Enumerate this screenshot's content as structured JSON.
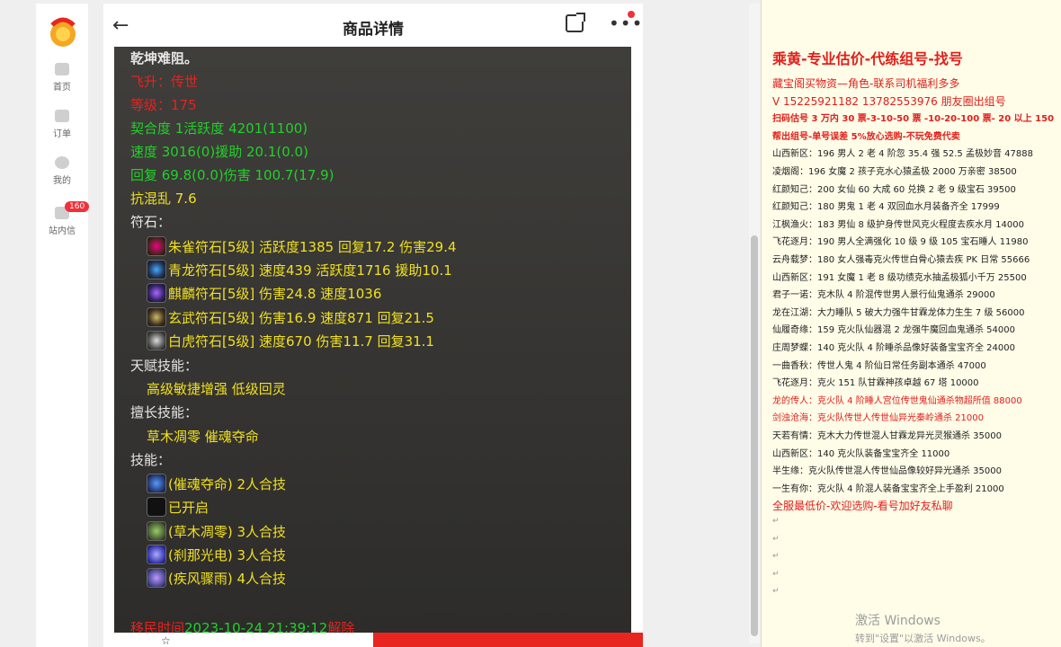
{
  "nav": {
    "items": [
      {
        "label": "首页"
      },
      {
        "label": "订单"
      },
      {
        "label": "我的"
      },
      {
        "label": "站内信",
        "badge": "160"
      }
    ]
  },
  "header": {
    "title": "商品详情"
  },
  "detail": {
    "lines": [
      {
        "text": "乾坤难阻。",
        "color": "w"
      },
      {
        "text": "飞升：传世",
        "color": "r"
      },
      {
        "text": "等级：175",
        "color": "r"
      },
      {
        "text": "契合度     1活跃度  4201(1100)",
        "color": "g"
      },
      {
        "text": "速度     3016(0)援助     20.1(0.0)",
        "color": "g"
      },
      {
        "text": "回复     69.8(0.0)伤害   100.7(17.9)",
        "color": "g"
      },
      {
        "text": "抗混乱 7.6",
        "color": "y"
      },
      {
        "text": "符石：",
        "color": "w"
      }
    ],
    "runes": [
      "朱雀符石[5级] 活跃度1385 回复17.2 伤害29.4",
      "青龙符石[5级] 速度439 活跃度1716 援助10.1",
      "麒麟符石[5级] 伤害24.8 速度1036",
      "玄武符石[5级] 伤害16.9 速度871 回复21.5",
      "白虎符石[5级] 速度670 伤害11.7 回复31.1"
    ],
    "talent_label": "天赋技能：",
    "talents": "高级敏捷增强     低级回灵",
    "specialty_label": "擅长技能：",
    "specialties": "草木凋零     催魂夺命",
    "skills_label": "技能：",
    "skills": [
      "(催魂夺命) 2人合技",
      "已开启",
      "(草木凋零) 3人合技",
      "(刹那光电) 3人合技",
      "(疾风骤雨) 4人合技"
    ],
    "footer": {
      "prefix": "移民时间",
      "time": "2023-10-24 21:39:12",
      "suffix": "解除"
    }
  },
  "doc": {
    "heading": "乘黄-专业估价-代练组号-找号",
    "lines": [
      {
        "text": "藏宝阁买物资—角色-联系司机福利多多",
        "style": "red big"
      },
      {
        "text": "V 15225921182   13782553976 朋友圈出组号",
        "style": "red big"
      },
      {
        "text": "扫码估号 3 万内 30 票-3-10-50 票  -10-20-100 票- 20 以上 150",
        "style": "red bold"
      },
      {
        "text": "帮出组号-单号误差 5%放心选购-不玩免费代卖",
        "style": "red bold"
      },
      {
        "text": "山西新区：196 男人 2 老 4 阶忽 35.4 强 52.5 孟极妙音 47888",
        "style": ""
      },
      {
        "text": "凌烟阁：196 女魔 2 孩子克水心猿孟极 2000 万亲密 38500",
        "style": ""
      },
      {
        "text": "红颜知己：200 女仙 60 大成 60 兑换 2 老 9 级宝石 39500",
        "style": ""
      },
      {
        "text": "红颜知己：180 男鬼 1 老 4 双回血水月装备齐全 17999",
        "style": ""
      },
      {
        "text": "江枫渔火：183 男仙 8 级护身传世风克火程度去疾水月 14000",
        "style": ""
      },
      {
        "text": "飞花逐月：190 男人全满强化 10 级 9 级 105 宝石睡人 11980",
        "style": ""
      },
      {
        "text": "云舟载梦：180 女人强毒克火传世白骨心猿去疾 PK 日常 55666",
        "style": ""
      },
      {
        "text": "山西新区：191 女魔 1 老 8 级功绩克水抽孟极狐小千万 25500",
        "style": ""
      },
      {
        "text": "君子一诺：克木队 4 阶混传世男人景行仙鬼通杀 29000",
        "style": ""
      },
      {
        "text": "龙在江湖：大力睡队 5 破大力强牛甘霖龙体力生生 7 级 56000",
        "style": ""
      },
      {
        "text": "仙履奇缘：159 克火队仙器混 2 龙强牛魔回血鬼通杀 54000",
        "style": ""
      },
      {
        "text": "庄周梦蝶：140 克火队 4 阶睡杀品像好装备宝宝齐全 24000",
        "style": ""
      },
      {
        "text": "一曲香秋：传世人鬼 4 阶仙日常任务副本通杀 47000",
        "style": ""
      },
      {
        "text": "飞花逐月：克火 151 队甘霖神孩卓越 67 塔 10000",
        "style": ""
      },
      {
        "text": "龙的传人：克火队 4 阶睡人宫位传世鬼仙通杀物超所值 88000",
        "style": "red"
      },
      {
        "text": "剑浊沧海：克火队传世人传世仙异光秦岭通杀 21000",
        "style": "red"
      },
      {
        "text": "天若有情：克木大力传世混人甘霖龙异光灵猴通杀 35000",
        "style": ""
      },
      {
        "text": "山西新区：140 克火队装备宝宝齐全 11000",
        "style": ""
      },
      {
        "text": "半生缘：克火队传世混人传世仙品像较好异光通杀 35000",
        "style": ""
      },
      {
        "text": "一生有你：克火队 4 阶混人装备宝宝齐全上手盈利 21000",
        "style": ""
      },
      {
        "text": "全服最低价-欢迎选购-看号加好友私聊",
        "style": "red big"
      }
    ],
    "watermark": "激活 Windows",
    "watermark_sub": "转到\"设置\"以激活 Windows。"
  }
}
